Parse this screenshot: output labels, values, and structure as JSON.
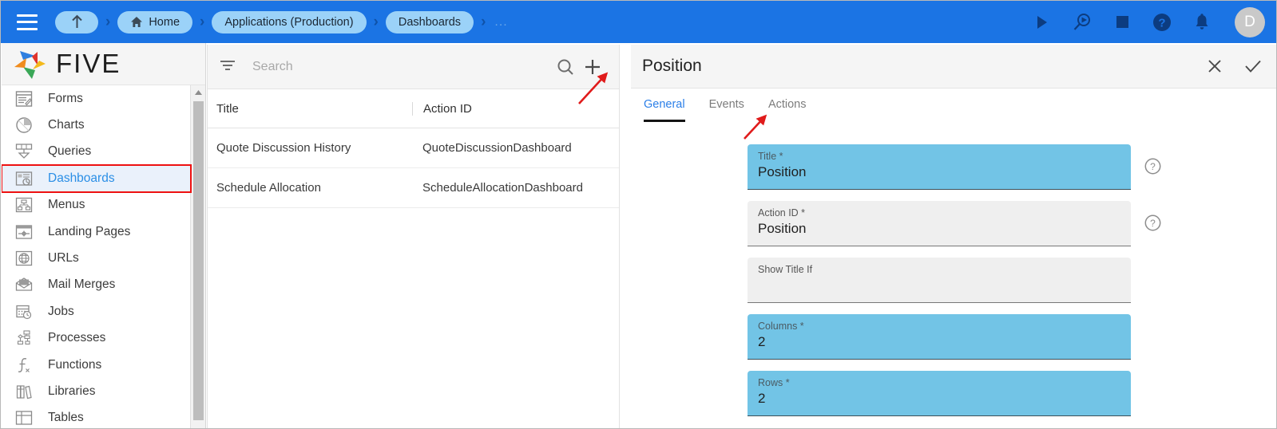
{
  "topbar": {
    "menu_icon": "hamburger-icon",
    "breadcrumbs": [
      {
        "label": "",
        "icon": "up-arrow-icon",
        "type": "round"
      },
      {
        "label": "Home",
        "icon": "home-icon",
        "type": "pill"
      },
      {
        "label": "Applications (Production)",
        "icon": "",
        "type": "pill"
      },
      {
        "label": "Dashboards",
        "icon": "",
        "type": "pill"
      }
    ],
    "separator": "›",
    "ellipsis": "...",
    "actions": [
      {
        "name": "run-icon",
        "title": "Run"
      },
      {
        "name": "debug-search-icon",
        "title": "Debug"
      },
      {
        "name": "stop-icon",
        "title": "Stop"
      },
      {
        "name": "help-icon",
        "title": "Help"
      },
      {
        "name": "notifications-bell-icon",
        "title": "Notifications"
      }
    ],
    "avatar_initial": "D",
    "bg_color": "#1b74e4",
    "pill_color": "#9bd2f8"
  },
  "sidebar": {
    "logo_text": "FIVE",
    "items": [
      {
        "label": "Forms",
        "icon": "form-icon",
        "active": false
      },
      {
        "label": "Charts",
        "icon": "pie-chart-icon",
        "active": false
      },
      {
        "label": "Queries",
        "icon": "query-icon",
        "active": false
      },
      {
        "label": "Dashboards",
        "icon": "dashboard-icon",
        "active": true
      },
      {
        "label": "Menus",
        "icon": "menu-tree-icon",
        "active": false
      },
      {
        "label": "Landing Pages",
        "icon": "landing-page-icon",
        "active": false
      },
      {
        "label": "URLs",
        "icon": "globe-icon",
        "active": false
      },
      {
        "label": "Mail Merges",
        "icon": "mail-merge-icon",
        "active": false
      },
      {
        "label": "Jobs",
        "icon": "calendar-clock-icon",
        "active": false
      },
      {
        "label": "Processes",
        "icon": "process-flow-icon",
        "active": false
      },
      {
        "label": "Functions",
        "icon": "function-icon",
        "active": false
      },
      {
        "label": "Libraries",
        "icon": "books-icon",
        "active": false
      },
      {
        "label": "Tables",
        "icon": "table-icon",
        "active": false
      }
    ],
    "active_color": "#2b8fe6",
    "highlight_box_color": "#ee1111"
  },
  "list_panel": {
    "search_placeholder": "Search",
    "filter_icon": "filter-icon",
    "search_icon": "search-icon",
    "add_icon": "plus-icon",
    "columns": [
      "Title",
      "Action ID"
    ],
    "rows": [
      {
        "title": "Quote Discussion History",
        "action_id": "QuoteDiscussionDashboard"
      },
      {
        "title": "Schedule Allocation",
        "action_id": "ScheduleAllocationDashboard"
      }
    ]
  },
  "detail": {
    "title": "Position",
    "close_icon": "close-icon",
    "confirm_icon": "check-icon",
    "tabs": [
      {
        "label": "General",
        "active": true
      },
      {
        "label": "Events",
        "active": false
      },
      {
        "label": "Actions",
        "active": false
      }
    ],
    "fields": [
      {
        "label": "Title *",
        "value": "Position",
        "highlighted": true,
        "has_help": true
      },
      {
        "label": "Action ID *",
        "value": "Position",
        "highlighted": false,
        "has_help": true
      },
      {
        "label": "Show Title If",
        "value": "",
        "highlighted": false,
        "has_help": false
      },
      {
        "label": "Columns *",
        "value": "2",
        "highlighted": true,
        "has_help": false
      },
      {
        "label": "Rows *",
        "value": "2",
        "highlighted": true,
        "has_help": false
      }
    ],
    "highlight_color": "#72c4e6"
  },
  "annotations": [
    {
      "name": "arrow-to-add-button",
      "color": "#e01b1b"
    },
    {
      "name": "arrow-to-actions-tab",
      "color": "#e01b1b"
    }
  ]
}
